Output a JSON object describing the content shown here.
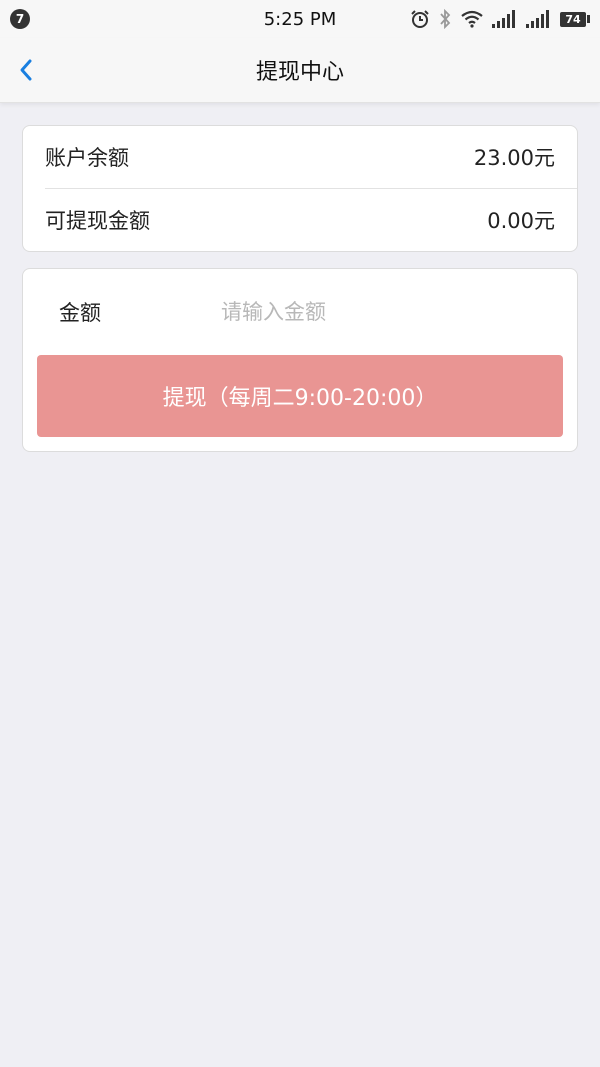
{
  "status_bar": {
    "notification_count": "7",
    "time": "5:25 PM",
    "battery": "74",
    "icons": [
      "alarm-icon",
      "bluetooth-icon",
      "wifi-icon",
      "signal-icon",
      "signal-icon",
      "battery-icon"
    ]
  },
  "nav": {
    "title": "提现中心",
    "back_icon": "chevron-left-icon"
  },
  "balance": {
    "rows": [
      {
        "label": "账户余额",
        "value": "23.00元"
      },
      {
        "label": "可提现金额",
        "value": "0.00元"
      }
    ]
  },
  "withdraw": {
    "amount_label": "金额",
    "amount_placeholder": "请输入金额",
    "amount_value": "",
    "button_label": "提现（每周二9:00-20:00）"
  },
  "colors": {
    "accent": "#1a7fe0",
    "button": "#e99593",
    "background": "#efeff4"
  }
}
